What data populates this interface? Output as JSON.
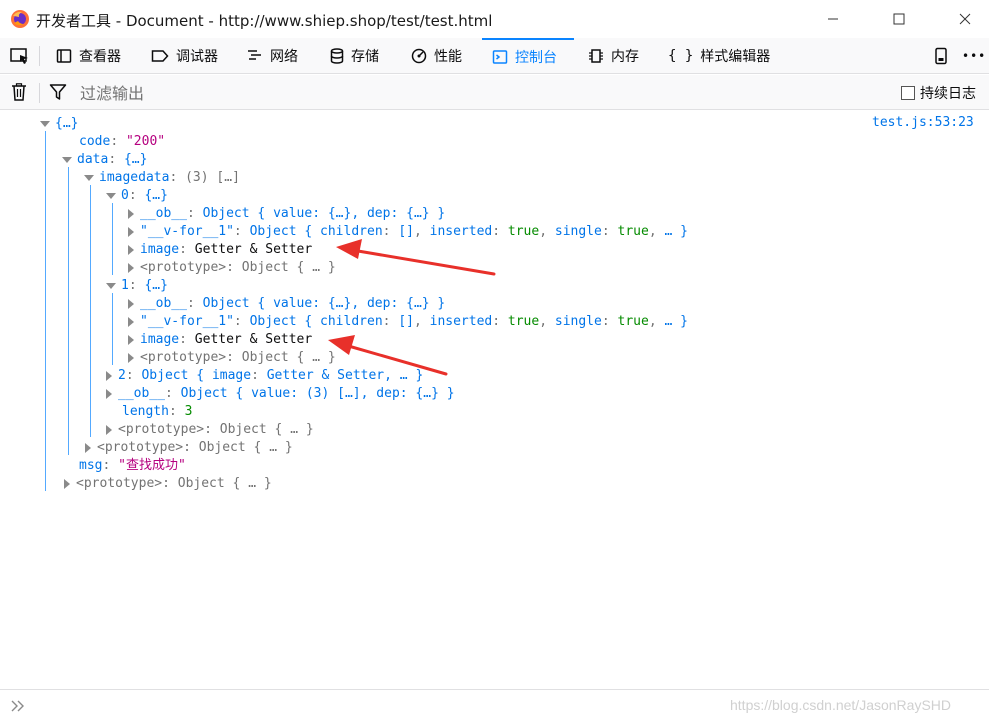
{
  "window": {
    "title": "开发者工具 - Document - http://www.shiep.shop/test/test.html",
    "minimize": "—",
    "maximize": "☐",
    "close": "✕"
  },
  "toolbar": {
    "tabs": [
      {
        "label": "查看器",
        "icon": "inspector-icon"
      },
      {
        "label": "调试器",
        "icon": "debugger-icon"
      },
      {
        "label": "网络",
        "icon": "network-icon"
      },
      {
        "label": "存储",
        "icon": "storage-icon"
      },
      {
        "label": "性能",
        "icon": "performance-icon"
      },
      {
        "label": "控制台",
        "icon": "console-icon",
        "active": true
      },
      {
        "label": "内存",
        "icon": "memory-icon"
      },
      {
        "label": "样式编辑器",
        "icon": "style-editor-icon"
      }
    ],
    "more": "•••",
    "accent": "#0a84ff"
  },
  "filterbar": {
    "placeholder": "过滤输出",
    "persist_label": "持续日志"
  },
  "console": {
    "source": "test.js:53:23",
    "root": "{…}",
    "code_key": "code",
    "code_val": "\"200\"",
    "data_key": "data",
    "data_val": "{…}",
    "imagedata_key": "imagedata",
    "imagedata_val": "(3) […]",
    "idx0": "0",
    "idx1": "1",
    "idx2": "2",
    "obj_brace": "{…}",
    "ob_key": "__ob__",
    "ob_val": "Object { value: {…}, dep: {…} }",
    "vfor_key": "\"__v-for__1\"",
    "vfor_val_prefix": "Object { ",
    "children_key": "children",
    "children_val": "[]",
    "inserted_key": "inserted",
    "true_val": "true",
    "single_key": "single",
    "vfor_tail": "… }",
    "image_key": "image",
    "getter_setter": "Getter & Setter",
    "proto_key": "<prototype>",
    "proto_val": "Object { … }",
    "item2_val_prefix": "Object { ",
    "item2_tail": ", … }",
    "arr_ob_val": "Object { value: (3) […], dep: {…} }",
    "length_key": "length",
    "length_val": "3",
    "msg_key": "msg",
    "msg_val": "\"查找成功\""
  },
  "footer": {
    "prompt": "≫",
    "watermark": "https://blog.csdn.net/JasonRaySHD"
  }
}
